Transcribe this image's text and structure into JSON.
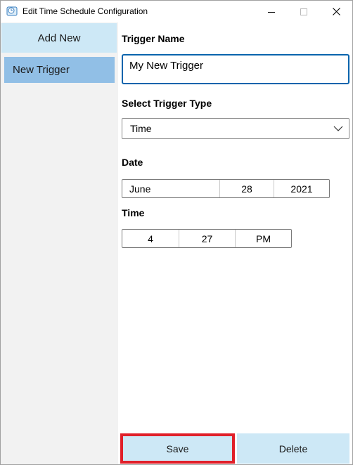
{
  "window": {
    "title": "Edit Time Schedule Configuration",
    "icons": {
      "app": "clock-app-icon",
      "minimize": "minimize-icon",
      "maximize": "maximize-icon",
      "close": "close-icon"
    }
  },
  "sidebar": {
    "add_new_label": "Add New",
    "items": [
      {
        "label": "New Trigger",
        "selected": true
      }
    ]
  },
  "form": {
    "trigger_name_label": "Trigger Name",
    "trigger_name_value": "My New Trigger",
    "trigger_type_label": "Select Trigger Type",
    "trigger_type_value": "Time",
    "date_label": "Date",
    "date": {
      "month": "June",
      "day": "28",
      "year": "2021"
    },
    "time_label": "Time",
    "time": {
      "hour": "4",
      "minute": "27",
      "period": "PM"
    }
  },
  "actions": {
    "save_label": "Save",
    "delete_label": "Delete"
  },
  "colors": {
    "accent_button": "#cde8f6",
    "selected_item": "#91bfe6",
    "sidebar_bg": "#f2f2f2",
    "focus_border": "#0a64ad",
    "highlight_border": "#e0202a"
  }
}
